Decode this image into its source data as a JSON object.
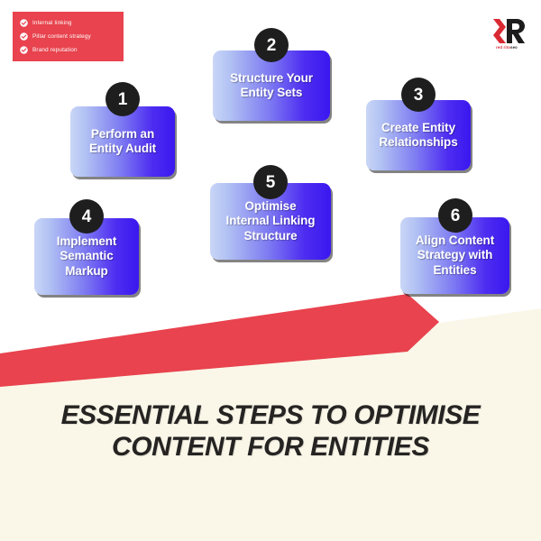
{
  "checklist": {
    "items": [
      {
        "label": "Internal linking",
        "icon": "check-circle-icon"
      },
      {
        "label": "Pillar content strategy",
        "icon": "check-circle-icon"
      },
      {
        "label": "Brand reputation",
        "icon": "check-circle-icon"
      }
    ],
    "background_color": "#E8434E",
    "text_color": "#FFFFFF"
  },
  "logo": {
    "mark": "r-monogram-icon",
    "text_red": "red rito",
    "text_black": "seo",
    "red": "#D92A33",
    "black": "#1C1C1C"
  },
  "steps": [
    {
      "number": "1",
      "label": "Perform an\nEntity Audit"
    },
    {
      "number": "2",
      "label": "Structure Your\nEntity Sets"
    },
    {
      "number": "3",
      "label": "Create Entity\nRelationships"
    },
    {
      "number": "4",
      "label": "Implement\nSemantic\nMarkup"
    },
    {
      "number": "5",
      "label": "Optimise\nInternal Linking\nStructure"
    },
    {
      "number": "6",
      "label": "Align Content\nStrategy with\nEntities"
    }
  ],
  "title": "ESSENTIAL STEPS TO OPTIMISE CONTENT FOR ENTITIES",
  "colors": {
    "page_background": "#FFFFFF",
    "cream_panel": "#FAF7E9",
    "accent_red": "#E8434E",
    "badge_dark": "#1E1E1E",
    "card_gradient_start": "#C9D6F7",
    "card_gradient_end": "#3A17EF",
    "title_color": "#262422"
  }
}
